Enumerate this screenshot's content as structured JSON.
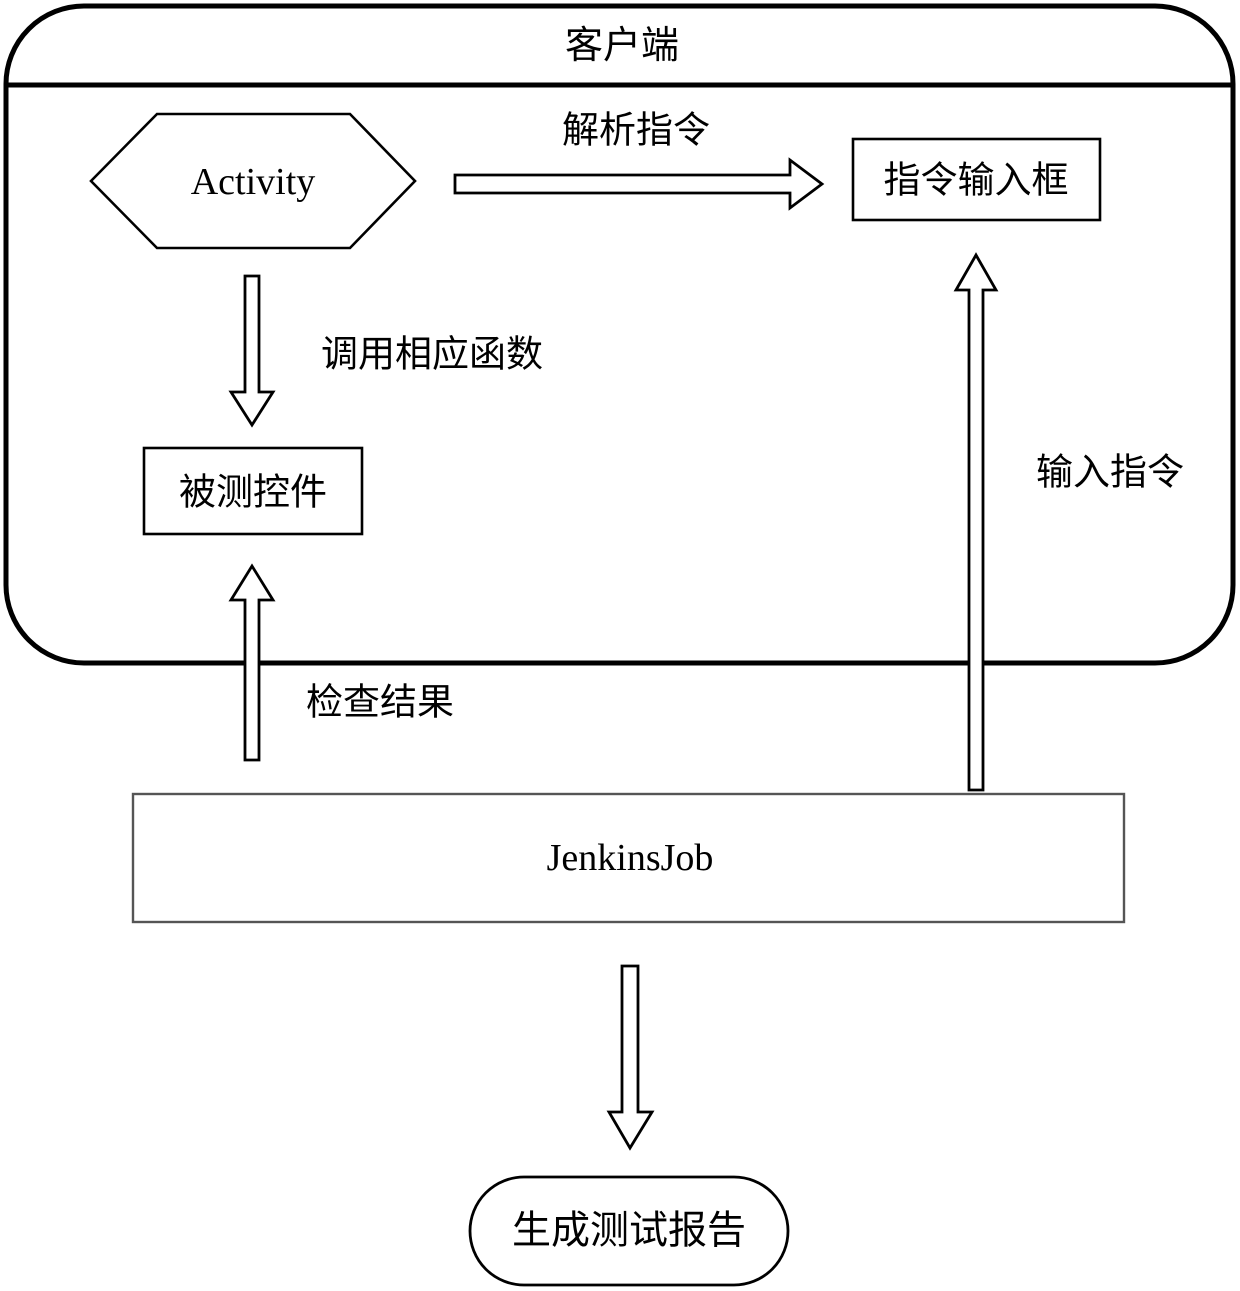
{
  "diagram": {
    "type": "flowchart",
    "title": "客户端",
    "background_color": "#ffffff",
    "stroke_color": "#000000",
    "container": {
      "label": "客户端",
      "shape": "rounded-rectangle",
      "header_divider": true
    },
    "nodes": [
      {
        "id": "activity",
        "label": "Activity",
        "shape": "hexagon",
        "script": "latin"
      },
      {
        "id": "command-input-box",
        "label": "指令输入框",
        "shape": "rectangle",
        "script": "cjk"
      },
      {
        "id": "widget-under-test",
        "label": "被测控件",
        "shape": "rectangle",
        "script": "cjk"
      },
      {
        "id": "jenkins-job",
        "label": "JenkinsJob",
        "shape": "rectangle",
        "script": "latin"
      },
      {
        "id": "generate-test-report",
        "label": "生成测试报告",
        "shape": "stadium",
        "script": "cjk"
      }
    ],
    "edges": [
      {
        "id": "parse-command",
        "label": "解析指令",
        "from": "activity",
        "to": "command-input-box",
        "direction": "right",
        "style": "block-arrow"
      },
      {
        "id": "call-function",
        "label": "调用相应函数",
        "from": "activity",
        "to": "widget-under-test",
        "direction": "down",
        "style": "block-arrow"
      },
      {
        "id": "input-command",
        "label": "输入指令",
        "from": "jenkins-job",
        "to": "command-input-box",
        "direction": "up",
        "style": "block-arrow"
      },
      {
        "id": "check-result",
        "label": "检查结果",
        "from": "jenkins-job",
        "to": "widget-under-test",
        "direction": "up",
        "style": "block-arrow"
      },
      {
        "id": "produce-report",
        "label": "",
        "from": "jenkins-job",
        "to": "generate-test-report",
        "direction": "down",
        "style": "block-arrow"
      }
    ]
  }
}
